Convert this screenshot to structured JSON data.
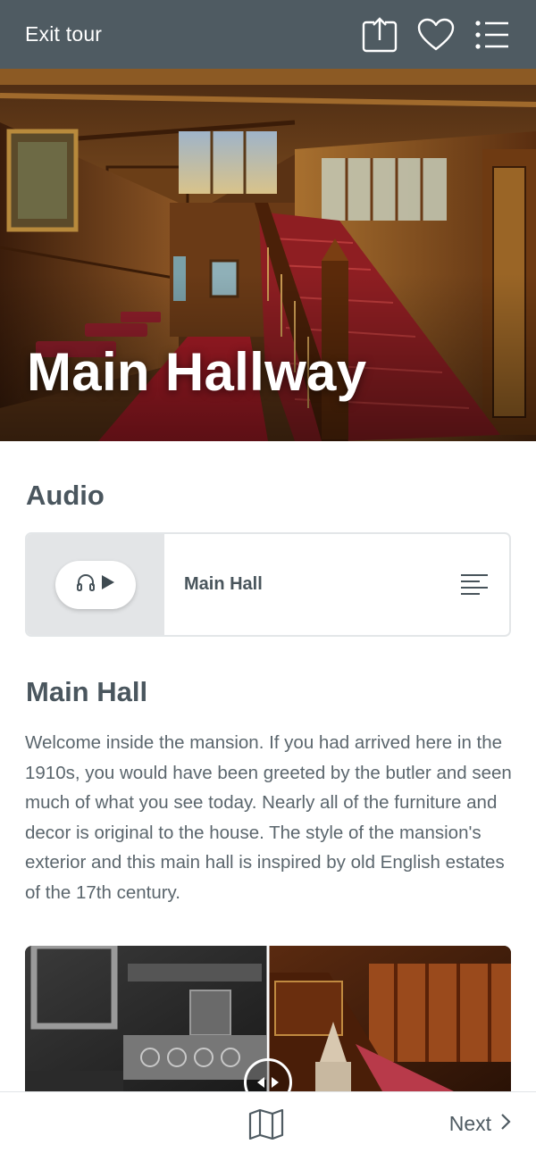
{
  "header": {
    "exit_label": "Exit tour",
    "icons": [
      "share-icon",
      "heart-icon",
      "list-menu-icon"
    ]
  },
  "hero": {
    "title": "Main Hallway"
  },
  "audio": {
    "section_title": "Audio",
    "track_label": "Main Hall",
    "icons": [
      "headphones-icon",
      "play-icon",
      "transcript-icon"
    ]
  },
  "article": {
    "title": "Main Hall",
    "body": "Welcome inside the mansion. If you had arrived here in the 1910s, you would have been greeted by the butler and seen much of what you see today. Nearly all of the furniture and decor is original to the house. The style of the mansion's exterior and this main hall is inspired by old English estates of the 17th century."
  },
  "compare_image": {
    "icons": [
      "compare-slider-handle-icon"
    ]
  },
  "footer": {
    "next_label": "Next",
    "icons": [
      "map-icon",
      "chevron-right-icon"
    ]
  },
  "colors": {
    "header_bg": "#4f5b62",
    "text": "#4a565e",
    "card_left_bg": "#e3e5e7"
  }
}
